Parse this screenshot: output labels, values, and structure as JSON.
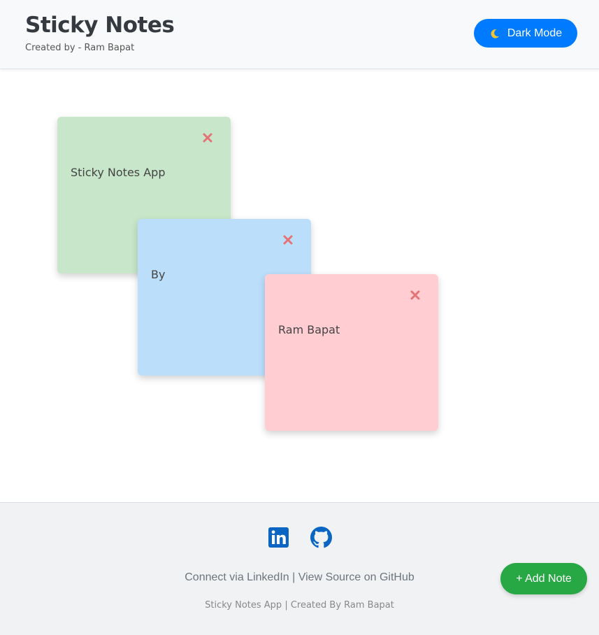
{
  "header": {
    "title": "Sticky Notes",
    "subtitle": "Created by - Ram Bapat",
    "dark_mode_label": "Dark Mode",
    "dark_mode_icon": "moon-icon"
  },
  "notes": [
    {
      "text": "Sticky Notes App",
      "color": "#c8e6c9",
      "close_icon": "close-icon"
    },
    {
      "text": "By",
      "color": "#bbdefb",
      "close_icon": "close-icon"
    },
    {
      "text": "Ram Bapat",
      "color": "#ffcdd2",
      "close_icon": "close-icon"
    }
  ],
  "footer": {
    "social_icons": [
      "linkedin-icon",
      "github-icon"
    ],
    "linkedin_label": "Connect via LinkedIn",
    "separator": "|",
    "github_label": "View Source on GitHub",
    "copyright": "Sticky Notes App | Created By Ram Bapat"
  },
  "add_note_label": "+ Add Note",
  "colors": {
    "primary": "#007bff",
    "success": "#28a745",
    "close": "#e57373",
    "social": "#0a66c2"
  }
}
